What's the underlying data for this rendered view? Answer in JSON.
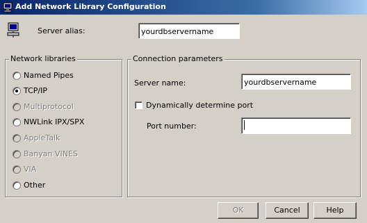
{
  "window": {
    "title": "Add Network Library Configuration",
    "icon": "network-computer-icon"
  },
  "server_alias": {
    "label": "Server alias:",
    "value": "yourdbservername"
  },
  "network_libraries": {
    "legend": "Network libraries",
    "options": [
      {
        "label": "Named Pipes",
        "selected": false,
        "enabled": true
      },
      {
        "label": "TCP/IP",
        "selected": true,
        "enabled": true
      },
      {
        "label": "Multiprotocol",
        "selected": false,
        "enabled": false
      },
      {
        "label": "NWLink IPX/SPX",
        "selected": false,
        "enabled": true
      },
      {
        "label": "AppleTalk",
        "selected": false,
        "enabled": false
      },
      {
        "label": "Banyan VINES",
        "selected": false,
        "enabled": false
      },
      {
        "label": "VIA",
        "selected": false,
        "enabled": false
      },
      {
        "label": "Other",
        "selected": false,
        "enabled": true
      }
    ]
  },
  "connection_parameters": {
    "legend": "Connection parameters",
    "server_name_label": "Server name:",
    "server_name_value": "yourdbservername",
    "dynamic_port_label": "Dynamically determine port",
    "dynamic_port_checked": false,
    "port_number_label": "Port number:",
    "port_number_value": ""
  },
  "buttons": {
    "ok": "OK",
    "cancel": "Cancel",
    "help": "Help"
  }
}
